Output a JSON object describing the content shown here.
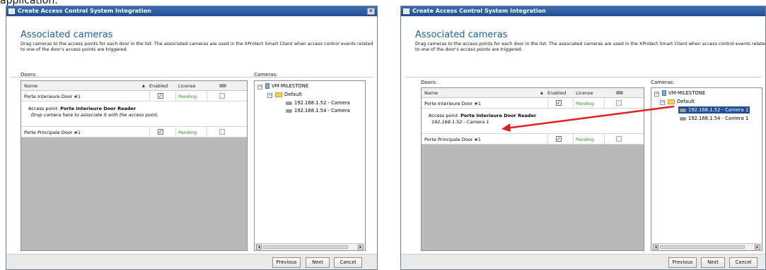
{
  "header_fragment": "application.",
  "window": {
    "title": "Create Access Control System Integration",
    "heading": "Associated cameras",
    "description": "Drag cameras to the access points for each door in the list. The associated cameras are used in the XProtect Smart Client when access control events related to one of the door's access points are triggered."
  },
  "doors": {
    "label": "Doors:",
    "columns": {
      "name": "Name",
      "enabled": "Enabled",
      "license": "License"
    },
    "rows": [
      {
        "name": "Porte Interieure Door #1",
        "license": "Pending"
      },
      {
        "name": "Porte Principale Door #1",
        "license": "Pending"
      }
    ],
    "access_point_prefix": "Access point:",
    "access_point_name": "Porte Interieure Door Reader",
    "drop_hint": "Drop camera here to associate it with the access point.",
    "associated_camera": "192.168.1.52 - Camera 1"
  },
  "cameras": {
    "label": "Cameras:",
    "server": "VM-MILESTONE",
    "group": "Default",
    "items_left": [
      "192.168.1.52 - Camera",
      "192.168.1.54 - Camera"
    ],
    "items_right": [
      "192.168.1.52 - Camera 1",
      "192.168.1.54 - Camera 1"
    ]
  },
  "buttons": {
    "previous": "Previous",
    "next": "Next",
    "cancel": "Cancel"
  },
  "colors": {
    "title_blue": "#1f5fa6",
    "pending_green": "#2f8f2f",
    "arrow_red": "#e02020",
    "selection": "#1e4f9a"
  }
}
